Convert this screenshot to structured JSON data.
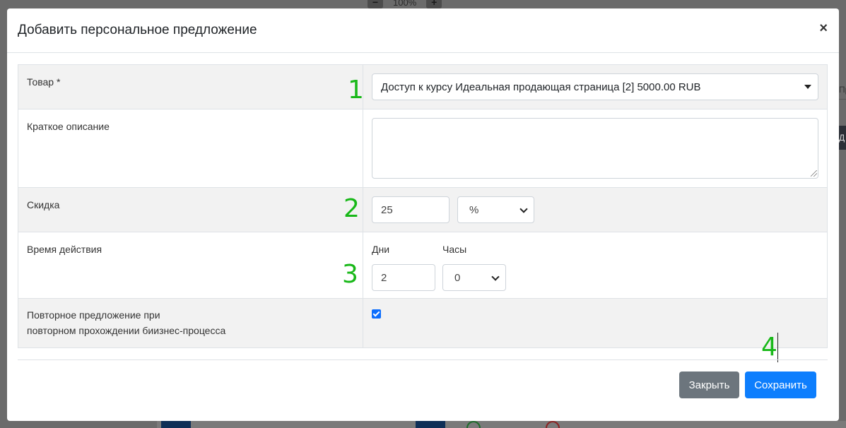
{
  "background": {
    "zoom_label": "100%",
    "minus_label": "−",
    "plus_label": "+",
    "right_edge_text": "Пр",
    "right_edge_dark_text": "Д"
  },
  "modal": {
    "title": "Добавить персональное предложение",
    "close_symbol": "×"
  },
  "form": {
    "product": {
      "label": "Товар *",
      "selected": "Доступ к курсу Идеальная продающая страница [2] 5000.00 RUB"
    },
    "description": {
      "label": "Краткое описание",
      "value": ""
    },
    "discount": {
      "label": "Скидка",
      "value": "25",
      "unit": "%"
    },
    "duration": {
      "label": "Время действия",
      "days_label": "Дни",
      "days_value": "2",
      "hours_label": "Часы",
      "hours_value": "0"
    },
    "repeat": {
      "label_line1": "Повторное предложение при",
      "label_line2": "повторном прохождении биизнес-процесса",
      "checked": true
    }
  },
  "markers": [
    "1",
    "2",
    "3",
    "4"
  ],
  "footer": {
    "close_label": "Закрыть",
    "save_label": "Сохранить"
  },
  "colors": {
    "primary": "#0d7efd",
    "secondary": "#6c757d",
    "marker": "#18b818"
  }
}
